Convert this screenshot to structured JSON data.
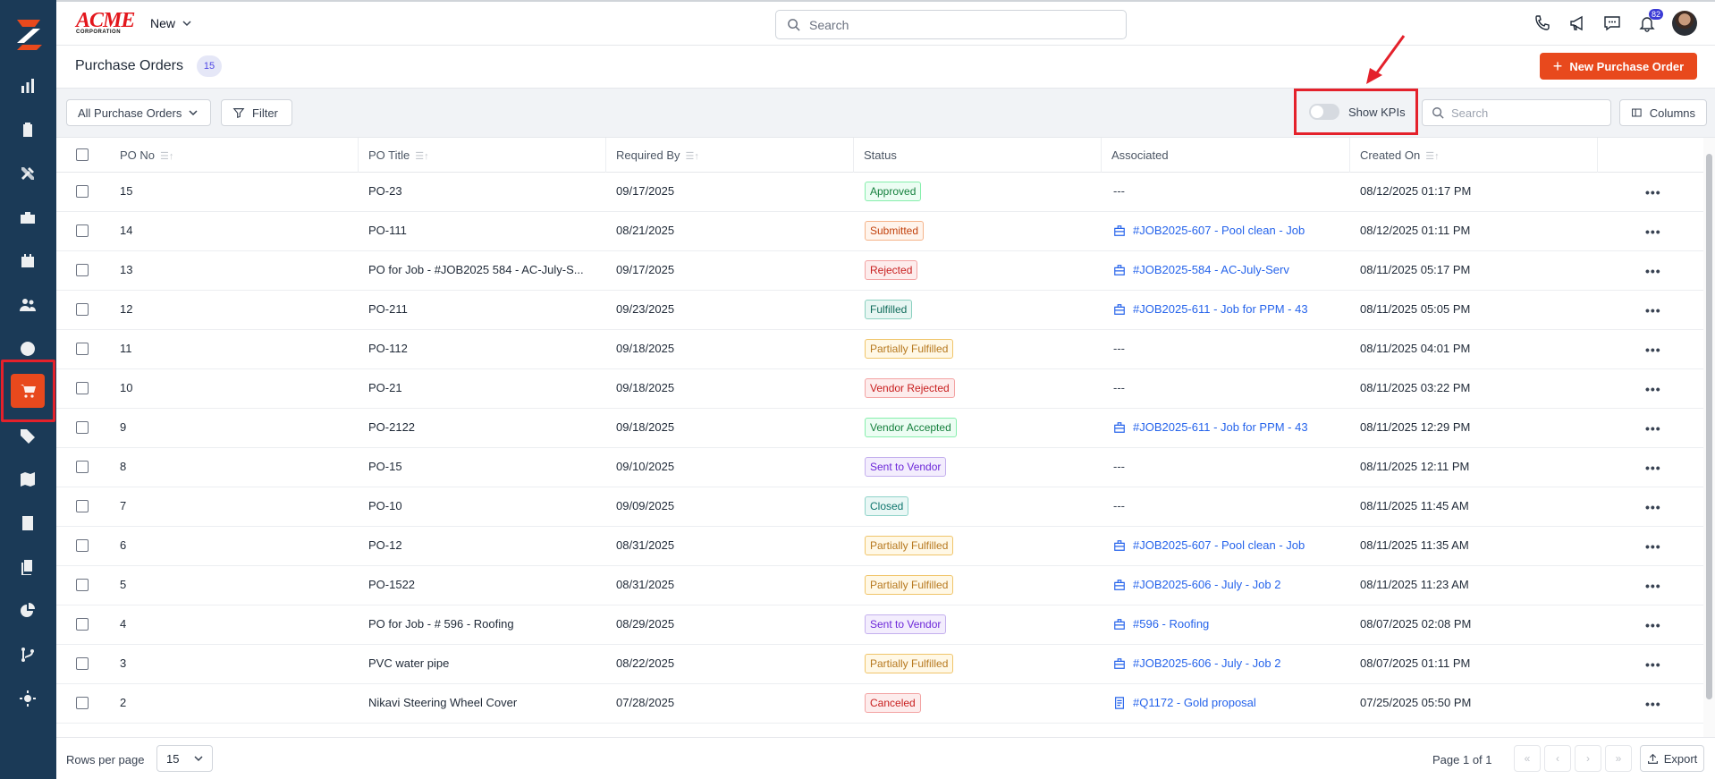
{
  "brand": {
    "logo_word": "ACME",
    "logo_sub": "CORPORATION"
  },
  "topbar": {
    "new_label": "New",
    "search_placeholder": "Search",
    "notification_count": "82"
  },
  "page": {
    "title": "Purchase Orders",
    "count": "15",
    "new_button": "New Purchase Order"
  },
  "toolbar": {
    "view_select": "All Purchase Orders",
    "filter_label": "Filter",
    "kpi_label": "Show KPIs",
    "kpi_enabled": false,
    "search_placeholder": "Search",
    "columns_label": "Columns"
  },
  "table": {
    "headers": [
      "PO No",
      "PO Title",
      "Required By",
      "Status",
      "Associated",
      "Created On"
    ],
    "rows": [
      {
        "po_no": "15",
        "title": "PO-23",
        "required_by": "09/17/2025",
        "status": "Approved",
        "associated": "---",
        "assoc_icon": "",
        "created_on": "08/12/2025 01:17 PM"
      },
      {
        "po_no": "14",
        "title": "PO-111",
        "required_by": "08/21/2025",
        "status": "Submitted",
        "associated": "#JOB2025-607 - Pool clean - Job",
        "assoc_icon": "briefcase-icon",
        "created_on": "08/12/2025 01:11 PM"
      },
      {
        "po_no": "13",
        "title": "PO for Job - #JOB2025 584 - AC-July-S...",
        "required_by": "09/17/2025",
        "status": "Rejected",
        "associated": "#JOB2025-584 - AC-July-Serv",
        "assoc_icon": "briefcase-icon",
        "created_on": "08/11/2025 05:17 PM"
      },
      {
        "po_no": "12",
        "title": "PO-211",
        "required_by": "09/23/2025",
        "status": "Fulfilled",
        "associated": "#JOB2025-611 - Job for PPM - 43",
        "assoc_icon": "briefcase-icon",
        "created_on": "08/11/2025 05:05 PM"
      },
      {
        "po_no": "11",
        "title": "PO-112",
        "required_by": "09/18/2025",
        "status": "Partially Fulfilled",
        "associated": "---",
        "assoc_icon": "",
        "created_on": "08/11/2025 04:01 PM"
      },
      {
        "po_no": "10",
        "title": "PO-21",
        "required_by": "09/18/2025",
        "status": "Vendor Rejected",
        "associated": "---",
        "assoc_icon": "",
        "created_on": "08/11/2025 03:22 PM"
      },
      {
        "po_no": "9",
        "title": "PO-2122",
        "required_by": "09/18/2025",
        "status": "Vendor Accepted",
        "associated": "#JOB2025-611 - Job for PPM - 43",
        "assoc_icon": "briefcase-icon",
        "created_on": "08/11/2025 12:29 PM"
      },
      {
        "po_no": "8",
        "title": "PO-15",
        "required_by": "09/10/2025",
        "status": "Sent to Vendor",
        "associated": "---",
        "assoc_icon": "",
        "created_on": "08/11/2025 12:11 PM"
      },
      {
        "po_no": "7",
        "title": "PO-10",
        "required_by": "09/09/2025",
        "status": "Closed",
        "associated": "---",
        "assoc_icon": "",
        "created_on": "08/11/2025 11:45 AM"
      },
      {
        "po_no": "6",
        "title": "PO-12",
        "required_by": "08/31/2025",
        "status": "Partially Fulfilled",
        "associated": "#JOB2025-607 - Pool clean - Job",
        "assoc_icon": "briefcase-icon",
        "created_on": "08/11/2025 11:35 AM"
      },
      {
        "po_no": "5",
        "title": "PO-1522",
        "required_by": "08/31/2025",
        "status": "Partially Fulfilled",
        "associated": "#JOB2025-606 - July - Job 2",
        "assoc_icon": "briefcase-icon",
        "created_on": "08/11/2025 11:23 AM"
      },
      {
        "po_no": "4",
        "title": "PO for Job - # 596 - Roofing",
        "required_by": "08/29/2025",
        "status": "Sent to Vendor",
        "associated": "#596 - Roofing",
        "assoc_icon": "briefcase-icon",
        "created_on": "08/07/2025 02:08 PM"
      },
      {
        "po_no": "3",
        "title": "PVC water pipe",
        "required_by": "08/22/2025",
        "status": "Partially Fulfilled",
        "associated": "#JOB2025-606 - July - Job 2",
        "assoc_icon": "briefcase-icon",
        "created_on": "08/07/2025 01:11 PM"
      },
      {
        "po_no": "2",
        "title": "Nikavi Steering Wheel Cover",
        "required_by": "07/28/2025",
        "status": "Canceled",
        "associated": "#Q1172 - Gold proposal",
        "assoc_icon": "document-icon",
        "created_on": "07/25/2025 05:50 PM"
      }
    ]
  },
  "status_colors": {
    "Approved": {
      "fg": "#15803d",
      "bg": "#ecfdf3",
      "border": "#86efac"
    },
    "Submitted": {
      "fg": "#c2410c",
      "bg": "#fff4ec",
      "border": "#f5b48a"
    },
    "Rejected": {
      "fg": "#c81e1e",
      "bg": "#fdecec",
      "border": "#f3a3a3"
    },
    "Fulfilled": {
      "fg": "#0f6b5a",
      "bg": "#e7f6f2",
      "border": "#8ad0c0"
    },
    "Partially Fulfilled": {
      "fg": "#b7791f",
      "bg": "#fff8e6",
      "border": "#f0c56a"
    },
    "Vendor Rejected": {
      "fg": "#c81e1e",
      "bg": "#fdecec",
      "border": "#f3a3a3"
    },
    "Vendor Accepted": {
      "fg": "#15803d",
      "bg": "#ecfdf3",
      "border": "#86efac"
    },
    "Sent to Vendor": {
      "fg": "#6d28d9",
      "bg": "#f3edfd",
      "border": "#c4b0ee"
    },
    "Closed": {
      "fg": "#0f766e",
      "bg": "#e9f7f5",
      "border": "#8fd3c9"
    },
    "Canceled": {
      "fg": "#c81e1e",
      "bg": "#fdecec",
      "border": "#f3a3a3"
    }
  },
  "footer": {
    "rows_label": "Rows per page",
    "rows_value": "15",
    "page_info": "Page 1 of 1",
    "export_label": "Export"
  },
  "colors": {
    "brand_orange": "#e8491d",
    "sidebar_bg": "#1b3a57",
    "link_blue": "#2563eb"
  }
}
